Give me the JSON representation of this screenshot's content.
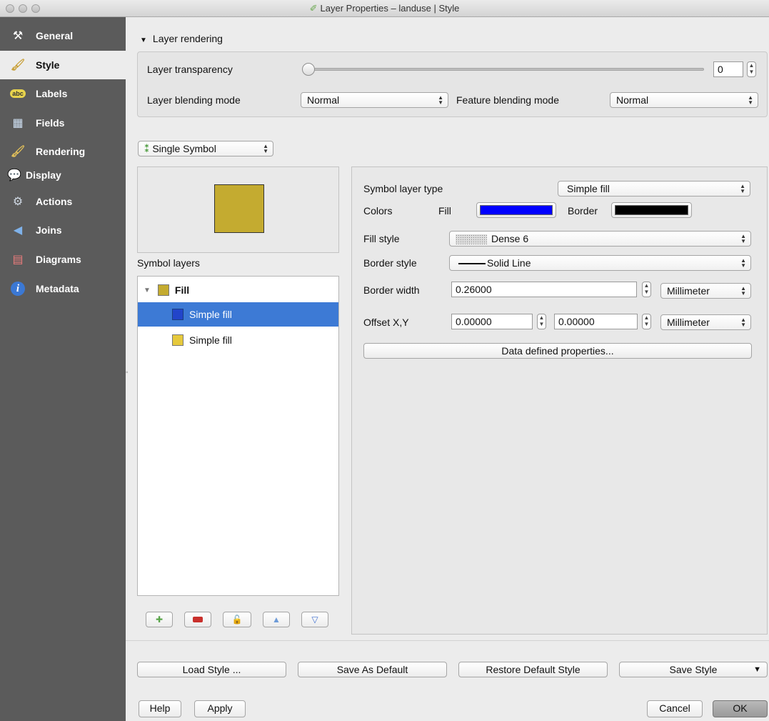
{
  "window": {
    "title": "Layer Properties – landuse | Style"
  },
  "sidebar": {
    "items": [
      {
        "label": "General",
        "icon": "tools-icon"
      },
      {
        "label": "Style",
        "icon": "paintbrush-icon"
      },
      {
        "label": "Labels",
        "icon": "abc-label-icon"
      },
      {
        "label": "Fields",
        "icon": "table-icon"
      },
      {
        "label": "Rendering",
        "icon": "brush-icon"
      },
      {
        "label": "Display",
        "icon": "speech-bubble-icon"
      },
      {
        "label": "Actions",
        "icon": "gear-play-icon"
      },
      {
        "label": "Joins",
        "icon": "join-arrow-icon"
      },
      {
        "label": "Diagrams",
        "icon": "chart-icon"
      },
      {
        "label": "Metadata",
        "icon": "info-icon"
      }
    ],
    "selected": "Style"
  },
  "layer_rendering": {
    "title": "Layer rendering",
    "transparency_label": "Layer transparency",
    "transparency_value": "0",
    "blending_label": "Layer blending mode",
    "blending_value": "Normal",
    "feature_blending_label": "Feature blending mode",
    "feature_blending_value": "Normal"
  },
  "renderer": {
    "value": "Single Symbol"
  },
  "symbol_layers": {
    "title": "Symbol layers",
    "items": [
      {
        "label": "Fill"
      },
      {
        "label": "Simple fill"
      },
      {
        "label": "Simple fill"
      }
    ],
    "selected_index": 1
  },
  "props": {
    "type_label": "Symbol layer type",
    "type_value": "Simple fill",
    "colors_label": "Colors",
    "fill_label": "Fill",
    "fill_color": "#0000ff",
    "border_label": "Border",
    "border_color": "#000000",
    "fill_style_label": "Fill style",
    "fill_style_value": "Dense 6",
    "border_style_label": "Border style",
    "border_style_value": "Solid Line",
    "border_width_label": "Border width",
    "border_width_value": "0.26000",
    "border_width_unit": "Millimeter",
    "offset_label": "Offset X,Y",
    "offset_x": "0.00000",
    "offset_y": "0.00000",
    "offset_unit": "Millimeter",
    "data_defined_label": "Data defined properties..."
  },
  "bottom": {
    "load_style": "Load Style ...",
    "save_default": "Save As Default",
    "restore_default": "Restore Default Style",
    "save_style": "Save Style",
    "help": "Help",
    "apply": "Apply",
    "cancel": "Cancel",
    "ok": "OK"
  },
  "colors": {
    "sidebar_bg": "#5b5b5b",
    "selection": "#3d7ad5",
    "preview_fill": "#e6c93c"
  }
}
